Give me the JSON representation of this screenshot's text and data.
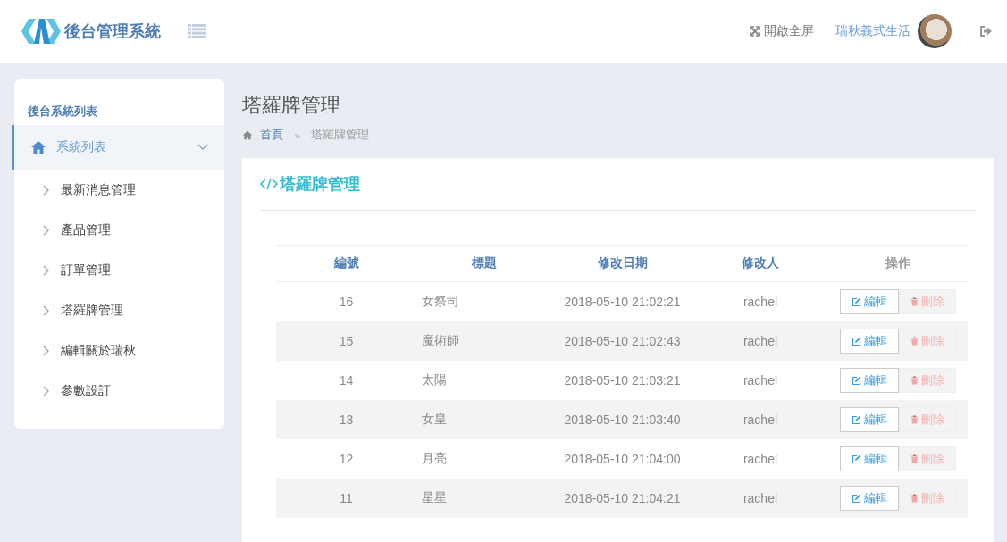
{
  "header": {
    "logo_text": "後台管理系統",
    "fullscreen": "開啟全屏",
    "user_name": "瑞秋義式生活"
  },
  "sidebar": {
    "heading": "後台系統列表",
    "group": {
      "label": "系統列表",
      "expanded": true,
      "selected": true
    },
    "items": [
      {
        "label": "最新消息管理"
      },
      {
        "label": "產品管理"
      },
      {
        "label": "訂單管理"
      },
      {
        "label": "塔羅牌管理"
      },
      {
        "label": "編輯關於瑞秋"
      },
      {
        "label": "參數設訂"
      }
    ]
  },
  "page": {
    "title": "塔羅牌管理",
    "breadcrumb": [
      {
        "label": "首頁"
      },
      {
        "label": "塔羅牌管理"
      }
    ],
    "separator": "»"
  },
  "panel": {
    "title": "塔羅牌管理",
    "table": {
      "columns": [
        "編號",
        "標題",
        "修改日期",
        "修改人",
        "操作"
      ],
      "rows": [
        {
          "id": "16",
          "title": "女祭司",
          "date": "2018-05-10 21:02:21",
          "editor": "rachel",
          "edit": "編輯",
          "delete": "刪除"
        },
        {
          "id": "15",
          "title": "魔術師",
          "date": "2018-05-10 21:02:43",
          "editor": "rachel",
          "edit": "編輯",
          "delete": "刪除"
        },
        {
          "id": "14",
          "title": "太陽",
          "date": "2018-05-10 21:03:21",
          "editor": "rachel",
          "edit": "編輯",
          "delete": "刪除"
        },
        {
          "id": "13",
          "title": "女皇",
          "date": "2018-05-10 21:03:40",
          "editor": "rachel",
          "edit": "編輯",
          "delete": "刪除"
        },
        {
          "id": "12",
          "title": "月亮",
          "date": "2018-05-10 21:04:00",
          "editor": "rachel",
          "edit": "編輯",
          "delete": "刪除"
        },
        {
          "id": "11",
          "title": "星星",
          "date": "2018-05-10 21:04:21",
          "editor": "rachel",
          "edit": "編輯",
          "delete": "刪除"
        }
      ]
    }
  }
}
